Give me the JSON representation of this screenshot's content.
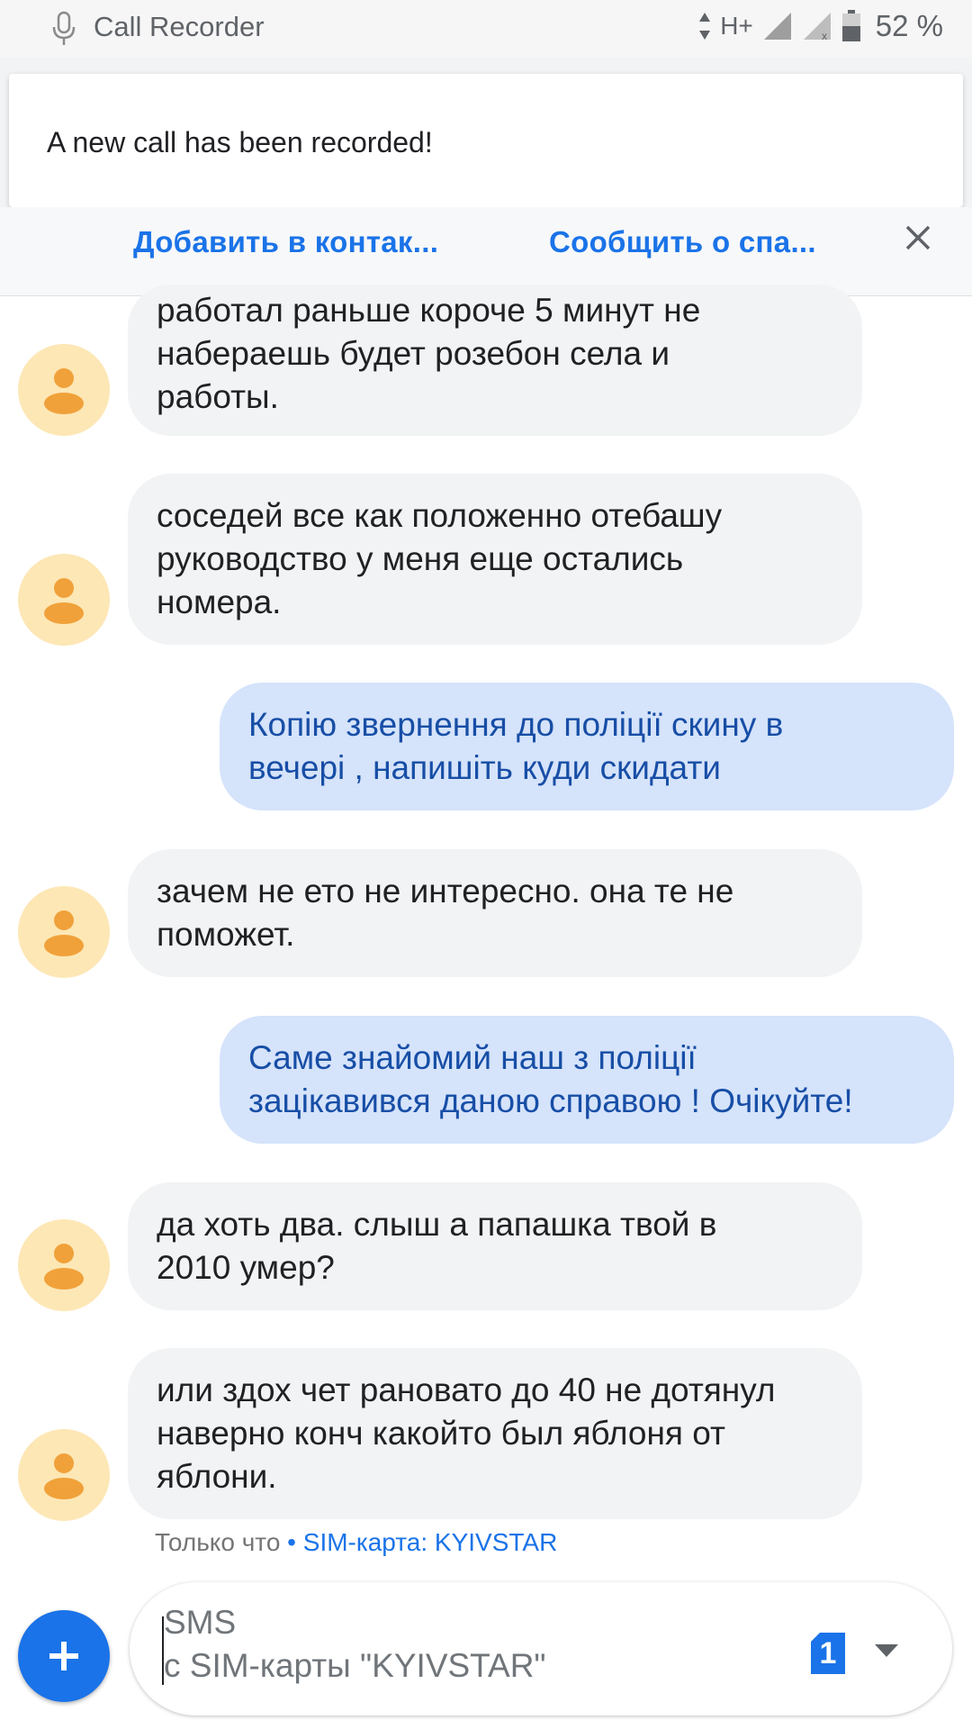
{
  "status_bar": {
    "app_name": "Call Recorder",
    "network": "H+",
    "battery": "52 %"
  },
  "notification": {
    "text": "A new call has been recorded!"
  },
  "snackbar": {
    "add_contact": "Добавить в контак...",
    "report_spam": "Сообщить о спа..."
  },
  "messages": [
    {
      "direction": "incoming",
      "text": "работал раньше короче 5 минут не\nнабераешь будет розебон села и\nработы."
    },
    {
      "direction": "incoming",
      "text": "соседей все как положенно отебашу\nруководство у меня еще остались\nномера."
    },
    {
      "direction": "outgoing",
      "text": "Копію звернення до поліції скину в\nвечері , напишіть куди скидати"
    },
    {
      "direction": "incoming",
      "text": "зачем не ето не интересно. она те не\nпоможет."
    },
    {
      "direction": "outgoing",
      "text": "Саме знайомий наш з поліції\nзацікавився даною справою ! Очікуйте!"
    },
    {
      "direction": "incoming",
      "text": "да хоть два. слыш а папашка твой в\n2010 умер?"
    },
    {
      "direction": "incoming",
      "text": "или здох чет рановато до 40 не дотянул\nнаверно конч какойто был яблоня от\nяблони."
    }
  ],
  "last_meta": {
    "time": "Только что",
    "separator": " • ",
    "sim": "SIM-карта: KYIVSTAR"
  },
  "composer": {
    "placeholder_line1": "SMS",
    "placeholder_line2": "с SIM-карты \"KYIVSTAR\"",
    "sim_number": "1"
  },
  "colors": {
    "accent": "#1a73e8",
    "incoming_bubble": "#f1f3f4",
    "outgoing_bubble": "#d5e3fb",
    "avatar_bg": "#fde7b5",
    "avatar_fg": "#f0a13a"
  },
  "icons": [
    "microphone-icon",
    "signal-icon",
    "battery-icon",
    "close-icon",
    "person-icon",
    "plus-icon",
    "sim-card-icon",
    "dropdown-arrow-icon"
  ]
}
